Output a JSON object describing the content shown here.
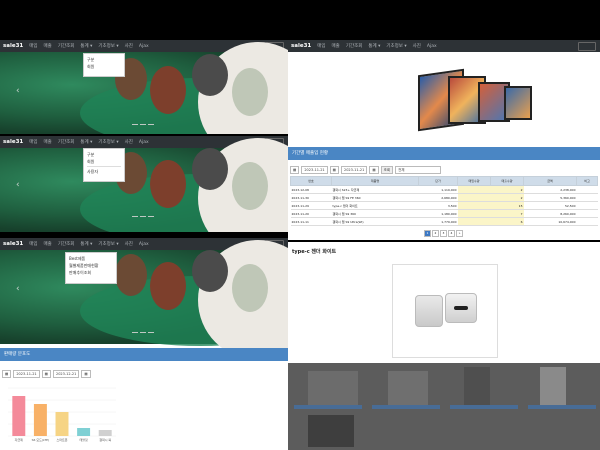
{
  "nav": {
    "brand": "sale31",
    "items": [
      "매입",
      "매출",
      "기간조회",
      "통계",
      "기초정보",
      "사진",
      "Ajax"
    ],
    "items_alt": [
      "매입",
      "매출",
      "기간조회",
      "통계 ▾",
      "기초정보 ▾",
      "사진",
      "Ajax"
    ]
  },
  "dropdowns": {
    "panel1": [
      "구분",
      "회원"
    ],
    "panel2": [
      "구분",
      "회원",
      "",
      "사용자"
    ],
    "panel3": [
      "Best제품",
      "월별제품판매현황",
      "판매추이조회"
    ]
  },
  "icons": {
    "prev": "chevron-left-icon",
    "calendar": "calendar-icon"
  },
  "report": {
    "title": "기간별 매출입 현황",
    "date_from": "2023-11-21",
    "date_to": "2023-11-21",
    "search_label": "조회",
    "select_value": "전체",
    "headers": [
      "번호",
      "제품명",
      "단가",
      "매입수량",
      "매출수량",
      "금액",
      "비고"
    ],
    "rows": [
      [
        "2023-12-08",
        "갤럭시 S23+ 자급제",
        "1,119,000",
        "",
        "2",
        "2,238,000",
        ""
      ],
      [
        "2023-11-30",
        "갤럭시 탭 S9 FE 360",
        "2,680,000",
        "",
        "2",
        "5,360,000",
        ""
      ],
      [
        "2023-11-29",
        "type-c 젠더 화이트",
        "3,500",
        "",
        "15",
        "52,500",
        ""
      ],
      [
        "2023-11-20",
        "갤럭시 탭 S9 360",
        "1,180,000",
        "",
        "7",
        "8,260,000",
        ""
      ],
      [
        "2023-11-11",
        "갤럭시 탭 S9 Ultra(Wi)",
        "1,779,000",
        "",
        "6",
        "10,674,000",
        ""
      ]
    ],
    "pages": [
      "1",
      "2",
      "3",
      "4",
      "»"
    ]
  },
  "stats": {
    "title": "판매량 분포도",
    "date_from": "2023-11-21",
    "date_to": "2023-12-21"
  },
  "product": {
    "title": "type-c 젠더 화이트"
  },
  "chart_data": {
    "type": "bar",
    "categories": [
      "자급제",
      "S6 모드(LTE)",
      "스마트폰",
      "태블릿",
      "갤럭시 북"
    ],
    "values": [
      10,
      8,
      6,
      2,
      1.5
    ],
    "colors": [
      "#f48a9a",
      "#f8b167",
      "#f6d485",
      "#7fd0d4",
      "#d0d0d0"
    ],
    "ylim": [
      0,
      12
    ]
  }
}
